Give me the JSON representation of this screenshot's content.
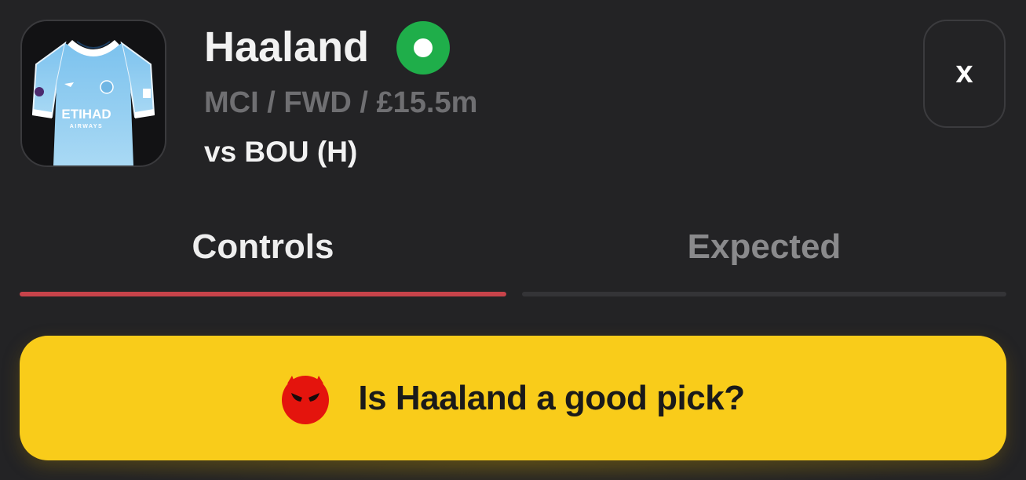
{
  "player": {
    "name": "Haaland",
    "meta": "MCI / FWD / £15.5m",
    "fixture": "vs BOU (H)",
    "status_color": "#1fae4a",
    "jersey_icon": "man-city-jersey"
  },
  "close": {
    "label": "x"
  },
  "tabs": [
    {
      "label": "Controls",
      "active": true
    },
    {
      "label": "Expected",
      "active": false
    }
  ],
  "cta": {
    "label": "Is Haaland a good pick?",
    "icon": "devil-face-icon",
    "background": "#f9cc1a"
  },
  "jersey": {
    "sponsor": "ETIHAD",
    "sponsor_sub": "AIRWAYS"
  },
  "colors": {
    "background": "#232325",
    "accent_tab": "#c8434a",
    "devil": "#e4140d"
  }
}
